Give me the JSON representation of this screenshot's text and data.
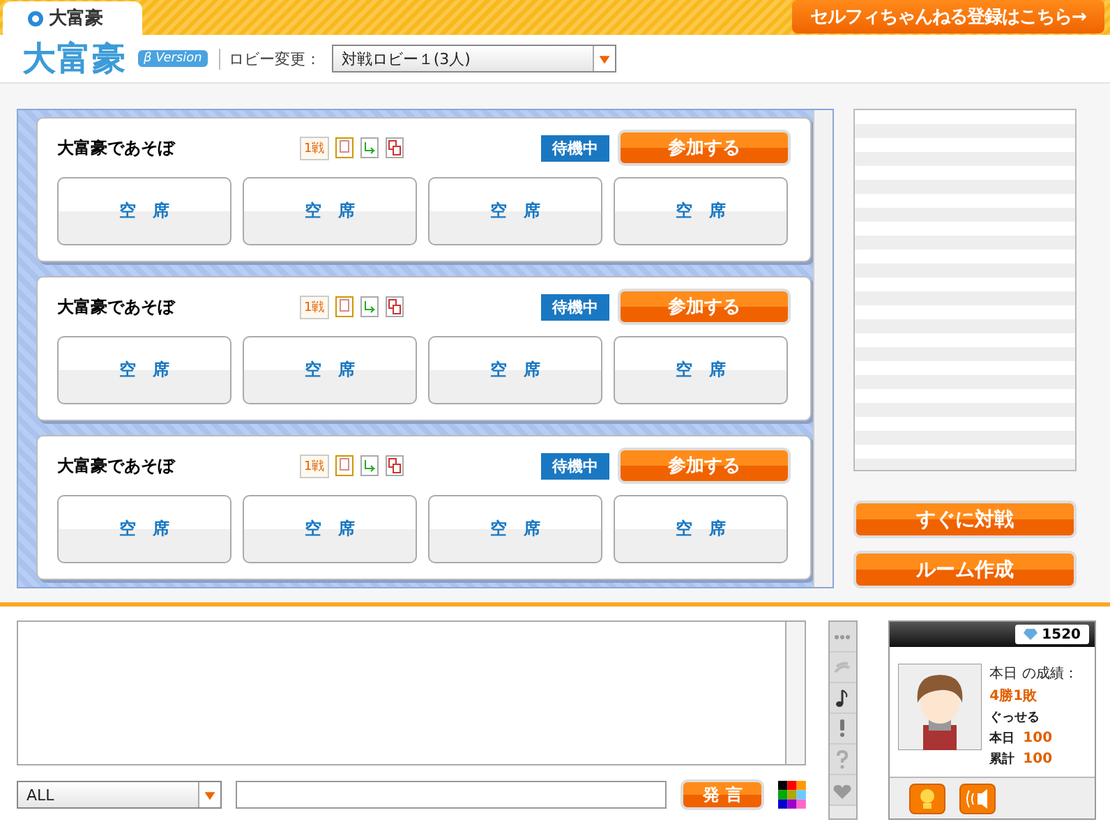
{
  "top_tab": {
    "label": "大富豪",
    "selected": true
  },
  "signup_link": "セルフィちゃんねる登録はこちら→",
  "header": {
    "logo": "大富豪",
    "badge": "β Version",
    "lobby_label": "ロビー変更：",
    "lobby_select": "対戦ロビー１(3人)"
  },
  "rooms": [
    {
      "name": "大富豪であそぼ",
      "match_count": "1戦",
      "status": "待機中",
      "join": "参加する",
      "seats": [
        "空　席",
        "空　席",
        "空　席",
        "空　席"
      ]
    },
    {
      "name": "大富豪であそぼ",
      "match_count": "1戦",
      "status": "待機中",
      "join": "参加する",
      "seats": [
        "空　席",
        "空　席",
        "空　席",
        "空　席"
      ]
    },
    {
      "name": "大富豪であそぼ",
      "match_count": "1戦",
      "status": "待機中",
      "join": "参加する",
      "seats": [
        "空　席",
        "空　席",
        "空　席",
        "空　席"
      ]
    }
  ],
  "quick_buttons": [
    "すぐに対戦",
    "ルーム作成"
  ],
  "chat": {
    "channel": "ALL",
    "send": "発 言"
  },
  "profile": {
    "points": "1520",
    "today_label": "本日 の成績：",
    "today_record": "4勝1敗",
    "name": "ぐっせる",
    "stats": [
      {
        "label": "本日",
        "value": "100"
      },
      {
        "label": "累計",
        "value": "100"
      }
    ]
  }
}
